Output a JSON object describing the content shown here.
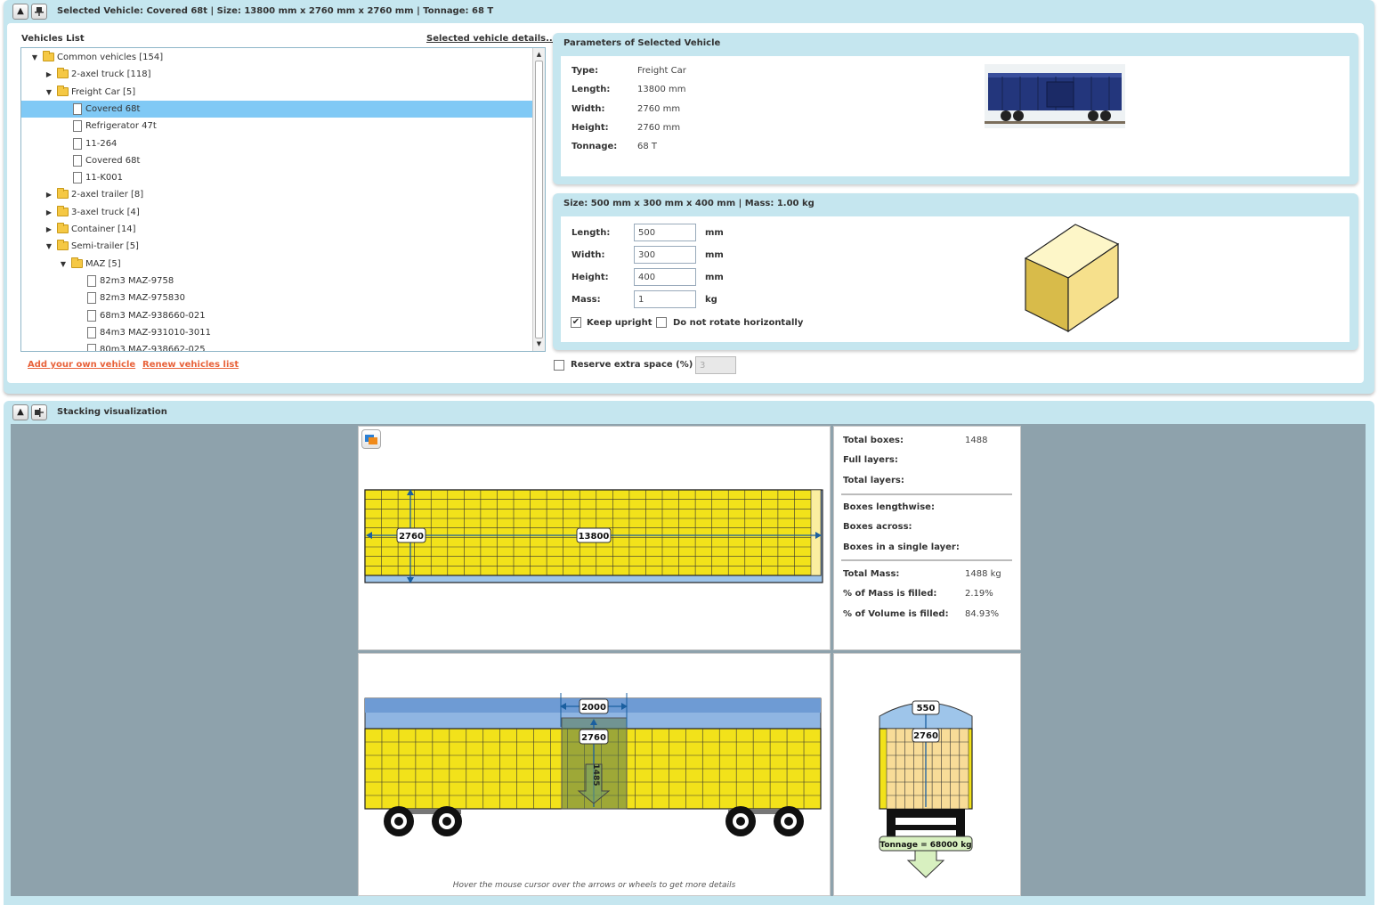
{
  "top_header": {
    "title": "Selected Vehicle: Covered 68t | Size: 13800 mm x 2760 mm x 2760 mm | Tonnage: 68 T"
  },
  "vehicles": {
    "list_title": "Vehicles List",
    "details_link": "Selected vehicle details...",
    "tree": [
      {
        "label": "Common vehicles [154]",
        "level": 0,
        "kind": "folder",
        "expanded": true
      },
      {
        "label": "2-axel truck [118]",
        "level": 1,
        "kind": "folder",
        "expanded": false
      },
      {
        "label": "Freight Car [5]",
        "level": 1,
        "kind": "folder",
        "expanded": true
      },
      {
        "label": "Covered 68t",
        "level": 2,
        "kind": "doc",
        "selected": true
      },
      {
        "label": "Refrigerator 47t",
        "level": 2,
        "kind": "doc"
      },
      {
        "label": "11-264",
        "level": 2,
        "kind": "doc"
      },
      {
        "label": "Covered 68t",
        "level": 2,
        "kind": "doc"
      },
      {
        "label": "11-K001",
        "level": 2,
        "kind": "doc"
      },
      {
        "label": "2-axel trailer [8]",
        "level": 1,
        "kind": "folder",
        "expanded": false
      },
      {
        "label": "3-axel truck [4]",
        "level": 1,
        "kind": "folder",
        "expanded": false
      },
      {
        "label": "Container [14]",
        "level": 1,
        "kind": "folder",
        "expanded": false
      },
      {
        "label": "Semi-trailer [5]",
        "level": 1,
        "kind": "folder",
        "expanded": true
      },
      {
        "label": "MAZ [5]",
        "level": 2,
        "kind": "folder",
        "expanded": true
      },
      {
        "label": "82m3 MAZ-9758",
        "level": 3,
        "kind": "doc"
      },
      {
        "label": "82m3 MAZ-975830",
        "level": 3,
        "kind": "doc"
      },
      {
        "label": "68m3 MAZ-938660-021",
        "level": 3,
        "kind": "doc"
      },
      {
        "label": "84m3 MAZ-931010-3011",
        "level": 3,
        "kind": "doc"
      },
      {
        "label": "80m3 MAZ-938662-025",
        "level": 3,
        "kind": "doc"
      }
    ],
    "add_link": "Add your own vehicle",
    "renew_link": "Renew vehicles list"
  },
  "params": {
    "title": "Parameters of Selected Vehicle",
    "rows": [
      {
        "label": "Type:",
        "value": "Freight Car"
      },
      {
        "label": "Length:",
        "value": "13800 mm"
      },
      {
        "label": "Width:",
        "value": "2760 mm"
      },
      {
        "label": "Height:",
        "value": "2760 mm"
      },
      {
        "label": "Tonnage:",
        "value": "68 T"
      }
    ]
  },
  "box": {
    "title": "Size: 500 mm x 300 mm x 400 mm | Mass: 1.00 kg",
    "fields": [
      {
        "label": "Length:",
        "value": "500",
        "unit": "mm"
      },
      {
        "label": "Width:",
        "value": "300",
        "unit": "mm"
      },
      {
        "label": "Height:",
        "value": "400",
        "unit": "mm"
      },
      {
        "label": "Mass:",
        "value": "1",
        "unit": "kg"
      }
    ],
    "keep_upright": {
      "label": "Keep upright",
      "checked": true
    },
    "no_rotate": {
      "label": "Do not rotate horizontally",
      "checked": false
    }
  },
  "reserve": {
    "label": "Reserve extra space (%)",
    "checked": false,
    "value": "3"
  },
  "viz": {
    "title": "Stacking visualization",
    "top_view": {
      "width_label": "2760",
      "length_label": "13800"
    },
    "side_view": {
      "gap_label": "2000",
      "height_label": "2760",
      "inner_label": "1485"
    },
    "front_view": {
      "roof_label": "550",
      "height_label": "2760",
      "tonnage_label": "Tonnage = 68000 kg"
    },
    "hint": "Hover the mouse cursor over the arrows or wheels to get more details"
  },
  "stats": {
    "group1": [
      {
        "label": "Total boxes:",
        "value": "1488"
      },
      {
        "label": "Full layers:",
        "value": ""
      },
      {
        "label": "Total layers:",
        "value": ""
      }
    ],
    "group2": [
      {
        "label": "Boxes lengthwise:",
        "value": ""
      },
      {
        "label": "Boxes across:",
        "value": ""
      },
      {
        "label": "Boxes in a single layer:",
        "value": ""
      }
    ],
    "group3": [
      {
        "label": "Total Mass:",
        "value": "1488 kg"
      },
      {
        "label": "% of Mass is filled:",
        "value": "2.19%"
      },
      {
        "label": "% of Volume is filled:",
        "value": "84.93%"
      }
    ]
  },
  "colors": {
    "panel": "#c5e6ef",
    "viz_bg": "#8ea2ac",
    "cargo": "#f2e21a",
    "selection": "#80c9f5",
    "link": "#e8623a"
  }
}
